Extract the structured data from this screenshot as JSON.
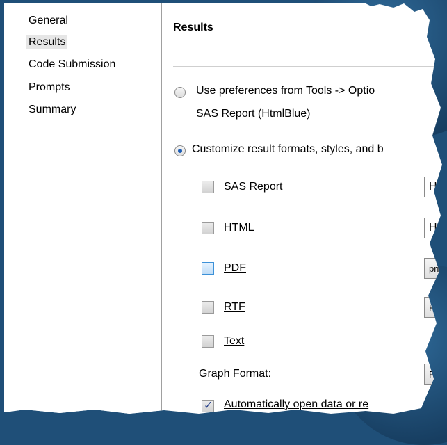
{
  "nav": {
    "items": [
      {
        "label": "General"
      },
      {
        "label": "Results"
      },
      {
        "label": "Code Submission"
      },
      {
        "label": "Prompts"
      },
      {
        "label": "Summary"
      }
    ]
  },
  "page": {
    "title": "Results",
    "option_prefs": {
      "label": "Use preferences from Tools -> Optio",
      "sublabel": "SAS Report (HtmlBlue)"
    },
    "option_customize": {
      "label": "Customize result formats, styles, and b"
    },
    "formats": [
      {
        "label": "SAS Report",
        "checked": false,
        "field": "Ht"
      },
      {
        "label": "HTML",
        "checked": false,
        "field": "H"
      },
      {
        "label": "PDF",
        "checked": false,
        "field": "pris"
      },
      {
        "label": "RTF",
        "checked": false,
        "field": "Ri"
      },
      {
        "label": "Text",
        "checked": false
      }
    ],
    "graph_format": {
      "label": "Graph Format:",
      "value": "PN"
    },
    "auto_open": {
      "label": "Automatically open data or re",
      "checked": true
    }
  }
}
